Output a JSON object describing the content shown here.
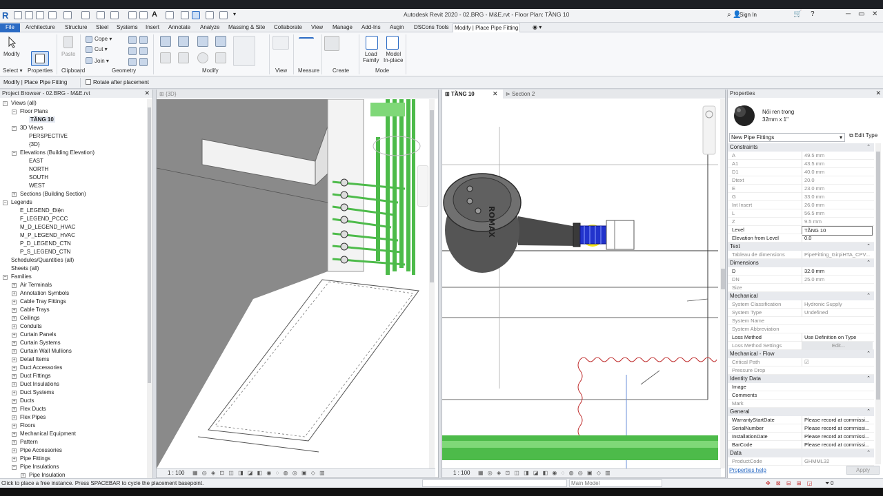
{
  "window": {
    "title": "Autodesk Revit 2020 - 02.BRG - M&E.rvt - Floor Plan: TẦNG 10",
    "logo_letter": "R",
    "sign_in": "Sign In"
  },
  "tabs": [
    "File",
    "Architecture",
    "Structure",
    "Steel",
    "Systems",
    "Insert",
    "Annotate",
    "Analyze",
    "Massing & Site",
    "Collaborate",
    "View",
    "Manage",
    "Add-Ins",
    "Augin",
    "DSCons Tools",
    "Modify | Place Pipe Fitting"
  ],
  "ribbon": {
    "modify": "Modify",
    "paste": "Paste",
    "cope": "Cope",
    "cut": "Cut",
    "join": "Join",
    "load_family": "Load\nFamily",
    "model_inplace": "Model\nIn-place",
    "panels": [
      "Select",
      "Properties",
      "Clipboard",
      "Geometry",
      "Modify",
      "View",
      "Measure",
      "Create",
      "Mode"
    ]
  },
  "optionsbar": {
    "context": "Modify | Place Pipe Fitting",
    "rotate_label": "Rotate after placement",
    "rotate_checked": false
  },
  "project_browser": {
    "title": "Project Browser - 02.BRG - M&E.rvt",
    "items": [
      {
        "label": "Views (all)",
        "level": 0,
        "toggle": "−"
      },
      {
        "label": "Floor Plans",
        "level": 1,
        "toggle": "−"
      },
      {
        "label": "TẦNG 10",
        "level": 2,
        "toggle": "",
        "bold": true
      },
      {
        "label": "3D Views",
        "level": 1,
        "toggle": "−"
      },
      {
        "label": "PERSPECTIVE",
        "level": 2,
        "toggle": ""
      },
      {
        "label": "{3D}",
        "level": 2,
        "toggle": ""
      },
      {
        "label": "Elevations (Building Elevation)",
        "level": 1,
        "toggle": "−"
      },
      {
        "label": "EAST",
        "level": 2,
        "toggle": ""
      },
      {
        "label": "NORTH",
        "level": 2,
        "toggle": ""
      },
      {
        "label": "SOUTH",
        "level": 2,
        "toggle": ""
      },
      {
        "label": "WEST",
        "level": 2,
        "toggle": ""
      },
      {
        "label": "Sections (Building Section)",
        "level": 1,
        "toggle": "+"
      },
      {
        "label": "Legends",
        "level": 0,
        "toggle": "−"
      },
      {
        "label": "E_LEGEND_Điện",
        "level": 1,
        "toggle": ""
      },
      {
        "label": "F_LEGEND_PCCC",
        "level": 1,
        "toggle": ""
      },
      {
        "label": "M_D_LEGEND_HVAC",
        "level": 1,
        "toggle": ""
      },
      {
        "label": "M_P_LEGEND_HVAC",
        "level": 1,
        "toggle": ""
      },
      {
        "label": "P_D_LEGEND_CTN",
        "level": 1,
        "toggle": ""
      },
      {
        "label": "P_S_LEGEND_CTN",
        "level": 1,
        "toggle": ""
      },
      {
        "label": "Schedules/Quantities (all)",
        "level": 0,
        "toggle": ""
      },
      {
        "label": "Sheets (all)",
        "level": 0,
        "toggle": ""
      },
      {
        "label": "Families",
        "level": 0,
        "toggle": "−"
      },
      {
        "label": "Air Terminals",
        "level": 1,
        "toggle": "+"
      },
      {
        "label": "Annotation Symbols",
        "level": 1,
        "toggle": "+"
      },
      {
        "label": "Cable Tray Fittings",
        "level": 1,
        "toggle": "+"
      },
      {
        "label": "Cable Trays",
        "level": 1,
        "toggle": "+"
      },
      {
        "label": "Ceilings",
        "level": 1,
        "toggle": "+"
      },
      {
        "label": "Conduits",
        "level": 1,
        "toggle": "+"
      },
      {
        "label": "Curtain Panels",
        "level": 1,
        "toggle": "+"
      },
      {
        "label": "Curtain Systems",
        "level": 1,
        "toggle": "+"
      },
      {
        "label": "Curtain Wall Mullions",
        "level": 1,
        "toggle": "+"
      },
      {
        "label": "Detail Items",
        "level": 1,
        "toggle": "+"
      },
      {
        "label": "Duct Accessories",
        "level": 1,
        "toggle": "+"
      },
      {
        "label": "Duct Fittings",
        "level": 1,
        "toggle": "+"
      },
      {
        "label": "Duct Insulations",
        "level": 1,
        "toggle": "+"
      },
      {
        "label": "Duct Systems",
        "level": 1,
        "toggle": "+"
      },
      {
        "label": "Ducts",
        "level": 1,
        "toggle": "+"
      },
      {
        "label": "Flex Ducts",
        "level": 1,
        "toggle": "+"
      },
      {
        "label": "Flex Pipes",
        "level": 1,
        "toggle": "+"
      },
      {
        "label": "Floors",
        "level": 1,
        "toggle": "+"
      },
      {
        "label": "Mechanical Equipment",
        "level": 1,
        "toggle": "+"
      },
      {
        "label": "Pattern",
        "level": 1,
        "toggle": "+"
      },
      {
        "label": "Pipe Accessories",
        "level": 1,
        "toggle": "+"
      },
      {
        "label": "Pipe Fittings",
        "level": 1,
        "toggle": "+"
      },
      {
        "label": "Pipe Insulations",
        "level": 1,
        "toggle": "−"
      },
      {
        "label": "Pipe Insulation",
        "level": 2,
        "toggle": "+"
      }
    ]
  },
  "views": {
    "view3d_tab": "{3D}",
    "plan_tab": "TẦNG 10",
    "section_tab": "Section 2",
    "scale": "1 : 100",
    "meter_text": "ROMAX"
  },
  "properties": {
    "title": "Properties",
    "family_name": "Nối ren trong",
    "family_size": "32mm x 1\"",
    "type_selector": "New Pipe Fittings",
    "edit_type": "Edit Type",
    "groups": [
      {
        "name": "Constraints",
        "rows": [
          {
            "n": "A",
            "v": "49.5 mm",
            "dim": true
          },
          {
            "n": "A1",
            "v": "43.5 mm",
            "dim": true
          },
          {
            "n": "D1",
            "v": "40.0 mm",
            "dim": true
          },
          {
            "n": "Dtext",
            "v": "20.0",
            "dim": true
          },
          {
            "n": "E",
            "v": "23.0 mm",
            "dim": true
          },
          {
            "n": "G",
            "v": "33.0 mm",
            "dim": true
          },
          {
            "n": "Int Insert",
            "v": "26.0 mm",
            "dim": true
          },
          {
            "n": "L",
            "v": "56.5 mm",
            "dim": true
          },
          {
            "n": "Z",
            "v": "9.5 mm",
            "dim": true
          },
          {
            "n": "Level",
            "v": "TẦNG 10",
            "dim": false,
            "boxed": true
          },
          {
            "n": "Elevation from Level",
            "v": "0.0",
            "dim": false
          }
        ]
      },
      {
        "name": "Text",
        "rows": [
          {
            "n": "Tableau de dimensions",
            "v": "PipeFitting_GirpiHTA_CPV...",
            "dim": true
          }
        ]
      },
      {
        "name": "Dimensions",
        "rows": [
          {
            "n": "D",
            "v": "32.0 mm",
            "dim": false
          },
          {
            "n": "DN",
            "v": "25.0 mm",
            "dim": true
          },
          {
            "n": "Size",
            "v": "",
            "dim": true
          }
        ]
      },
      {
        "name": "Mechanical",
        "rows": [
          {
            "n": "System Classification",
            "v": "Hydronic Supply",
            "dim": true
          },
          {
            "n": "System Type",
            "v": "Undefined",
            "dim": true
          },
          {
            "n": "System Name",
            "v": "",
            "dim": true
          },
          {
            "n": "System Abbreviation",
            "v": "",
            "dim": true
          },
          {
            "n": "Loss Method",
            "v": "Use Definition on Type",
            "dim": false
          },
          {
            "n": "Loss Method Settings",
            "v": "Edit...",
            "dim": true,
            "button": true
          }
        ]
      },
      {
        "name": "Mechanical - Flow",
        "rows": [
          {
            "n": "Critical Path",
            "v": "☑",
            "dim": true
          },
          {
            "n": "Pressure Drop",
            "v": "",
            "dim": true
          }
        ]
      },
      {
        "name": "Identity Data",
        "rows": [
          {
            "n": "Image",
            "v": "",
            "dim": false
          },
          {
            "n": "Comments",
            "v": "",
            "dim": false
          },
          {
            "n": "Mark",
            "v": "",
            "dim": true
          }
        ]
      },
      {
        "name": "General",
        "rows": [
          {
            "n": "WarrantyStartDate",
            "v": "Please record at commissi...",
            "dim": false
          },
          {
            "n": "SerialNumber",
            "v": "Please record at commissi...",
            "dim": false
          },
          {
            "n": "InstallationDate",
            "v": "Please record at commissi...",
            "dim": false
          },
          {
            "n": "BarCode",
            "v": "Please record at commissi...",
            "dim": false
          }
        ]
      },
      {
        "name": "Data",
        "rows": [
          {
            "n": "ProductCode",
            "v": "GHMML32",
            "dim": true
          }
        ]
      }
    ],
    "help_link": "Properties help",
    "apply": "Apply"
  },
  "statusbar": {
    "message": "Click to place a free instance. Press SPACEBAR to cycle the placement basepoint.",
    "workset": "Main Model",
    "filter_count": "0"
  },
  "colors": {
    "accent": "#2b6bc4",
    "pipe_green": "#4dbb4a",
    "fitting_blue": "#2233cc",
    "highlight_yellow": "#f5e51a"
  }
}
